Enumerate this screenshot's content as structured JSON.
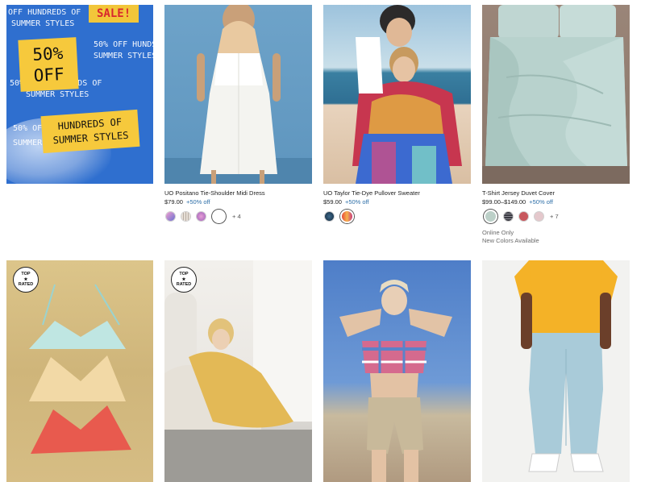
{
  "promo": {
    "sale": "SALE!",
    "off": "50% OFF",
    "styles": "HUNDREDS OF SUMMER STYLES",
    "background_lines": [
      "OFF HUNDREDS OF",
      "SUMMER STYLES",
      "50% OFF HUNDS",
      "SUMMER STYLES",
      "50% OFF HUNDREDS OF",
      "SUMMER STYLES",
      "50% OFF",
      "SUMMER S"
    ]
  },
  "products": [
    {
      "name": "UO Positano Tie-Shoulder Midi Dress",
      "price": "$79.00",
      "discount": "+50% off",
      "swatches": [
        "#b56fc9",
        "#e8e0d8",
        "#c98abf",
        "#ffffff"
      ],
      "more": "+ 4"
    },
    {
      "name": "UO Taylor Tie-Dye Pullover Sweater",
      "price": "$59.00",
      "discount": "+50% off",
      "swatches": [
        "#1f3f5e",
        "#e0583f"
      ],
      "more": ""
    },
    {
      "name": "T-Shirt Jersey Duvet Cover",
      "price": "$99.00–$149.00",
      "discount": "+50% off",
      "swatches": [
        "#bcd0c8",
        "#4a4a52",
        "#c8585e",
        "#e4c8cc"
      ],
      "more": "+ 7",
      "meta": [
        "Online Only",
        "New Colors Available"
      ]
    }
  ],
  "badges": [
    {
      "top": "TOP",
      "star": "★",
      "bottom": "RATED"
    },
    {
      "top": "TOP",
      "star": "★",
      "bottom": "RATED"
    }
  ],
  "colors": {
    "discount": "#2e6fa8",
    "promo_blue": "#2f6fcf",
    "promo_yellow": "#f6c93c"
  }
}
